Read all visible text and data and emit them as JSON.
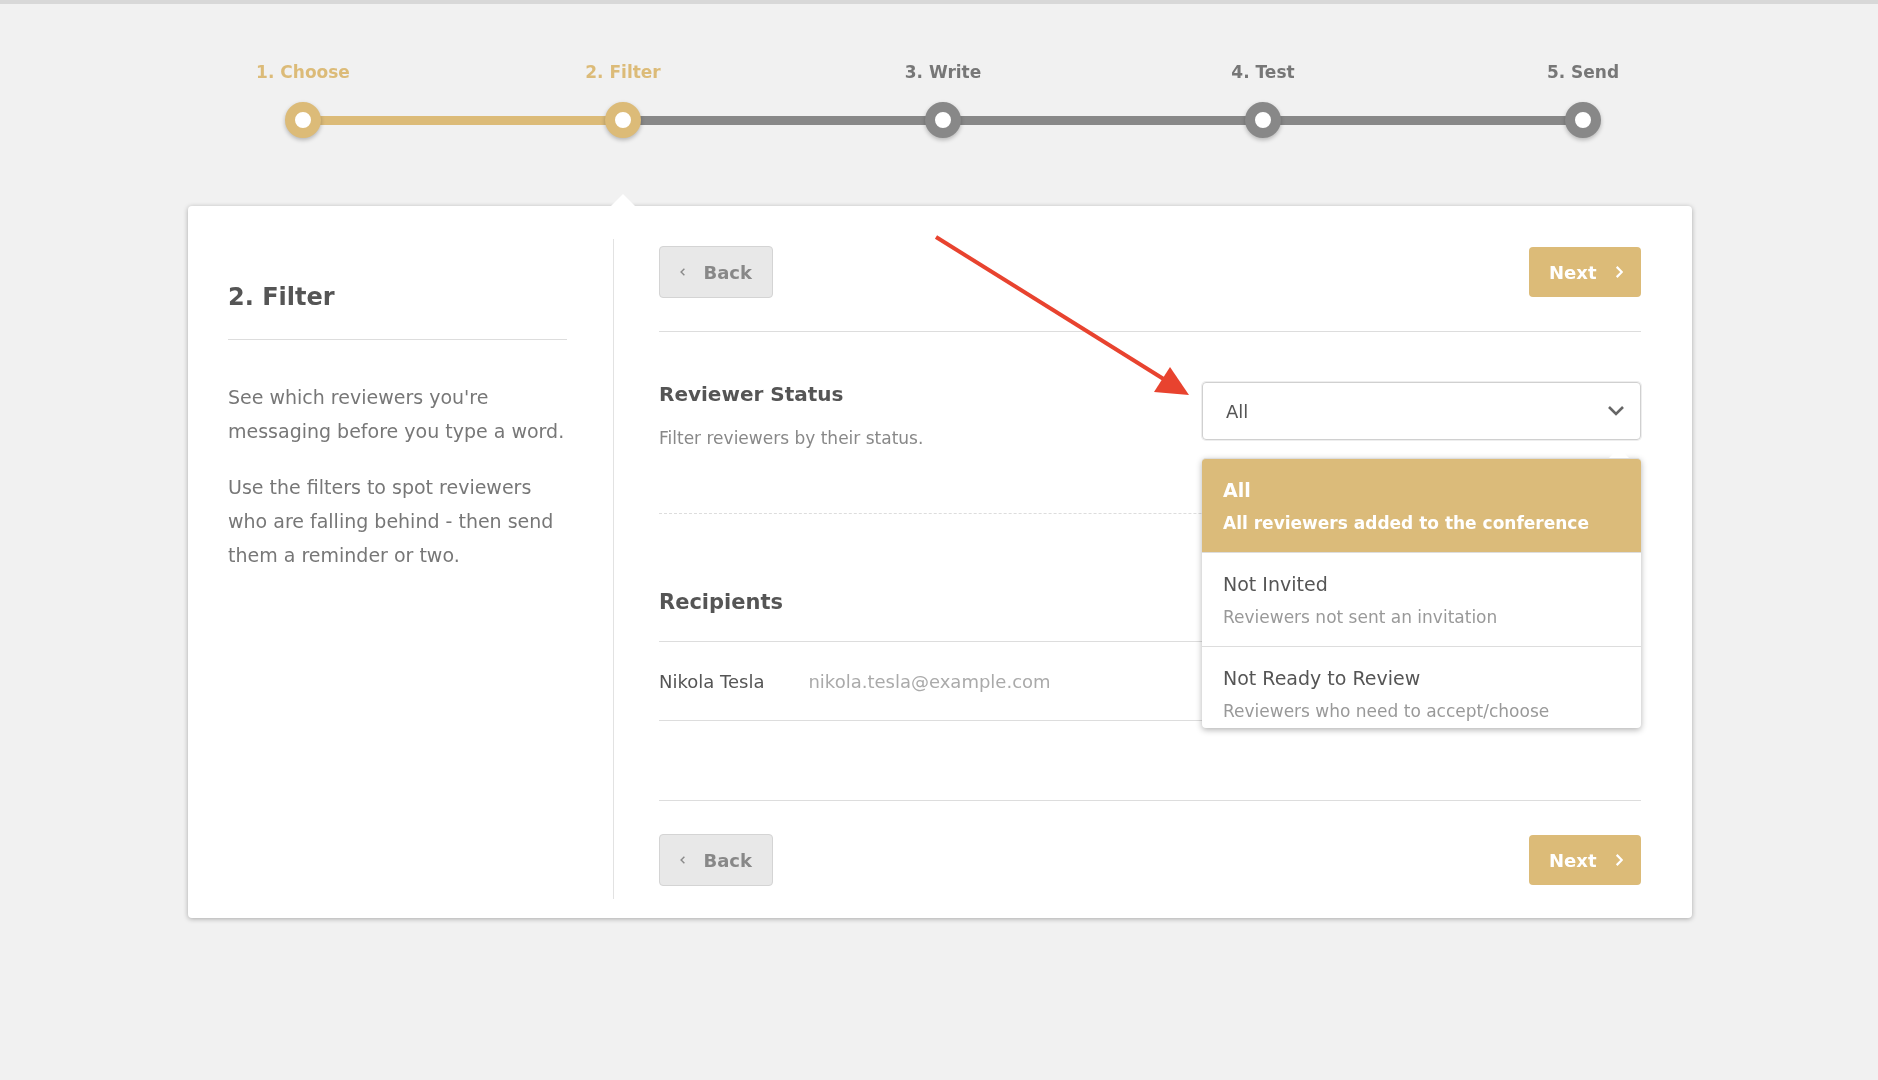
{
  "steps": [
    {
      "label": "1. Choose",
      "completed": true,
      "selected": false
    },
    {
      "label": "2. Filter",
      "completed": true,
      "selected": true
    },
    {
      "label": "3. Write",
      "completed": false,
      "selected": false
    },
    {
      "label": "4. Test",
      "completed": false,
      "selected": false
    },
    {
      "label": "5. Send",
      "completed": false,
      "selected": false
    }
  ],
  "sidebar": {
    "title": "2. Filter",
    "paragraphs": [
      "See which reviewers you're messaging before you type a word.",
      "Use the filters to spot reviewers who are falling behind - then send them a reminder or two."
    ]
  },
  "top_buttons": {
    "back": "Back",
    "next": "Next"
  },
  "filter": {
    "title": "Reviewer Status",
    "description": "Filter reviewers by their status.",
    "select_value": "All",
    "expanded": true,
    "options": [
      {
        "label": "All",
        "description": "All reviewers added to the conference",
        "selected": true
      },
      {
        "label": "Not Invited",
        "description": "Reviewers not sent an invitation",
        "selected": false
      },
      {
        "label": "Not Ready to Review",
        "description": "Reviewers who need to accept/choose",
        "selected": false
      }
    ]
  },
  "recipients": {
    "title": "Recipients",
    "rows": [
      {
        "name": "Nikola Tesla",
        "email": "nikola.tesla@example.com"
      }
    ]
  },
  "bottom_buttons": {
    "back": "Back",
    "next": "Next"
  }
}
